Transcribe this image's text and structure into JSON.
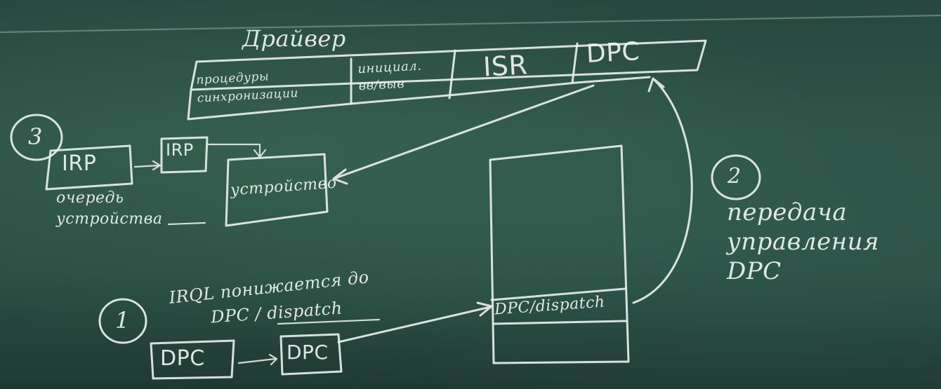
{
  "driver": {
    "title": "Драйвер",
    "cells": [
      "процедуры синхронизации",
      "инициал. вв/выв",
      "ISR",
      "DPC"
    ]
  },
  "step3": {
    "number": "3",
    "irp1": "IRP",
    "irp2": "IRP",
    "queue_label": "очередь устройства",
    "device": "устройство"
  },
  "step2": {
    "number": "2",
    "label": "передача управления DPC"
  },
  "step1": {
    "number": "1",
    "irql": "IRQL понижается до",
    "irql2": "DPC / dispatch",
    "dpc1": "DPC",
    "dpc2": "DPC"
  },
  "stack": {
    "level": "DPC/dispatch"
  },
  "colors": {
    "board": "#2d5246",
    "chalk": "#e8eee9"
  }
}
